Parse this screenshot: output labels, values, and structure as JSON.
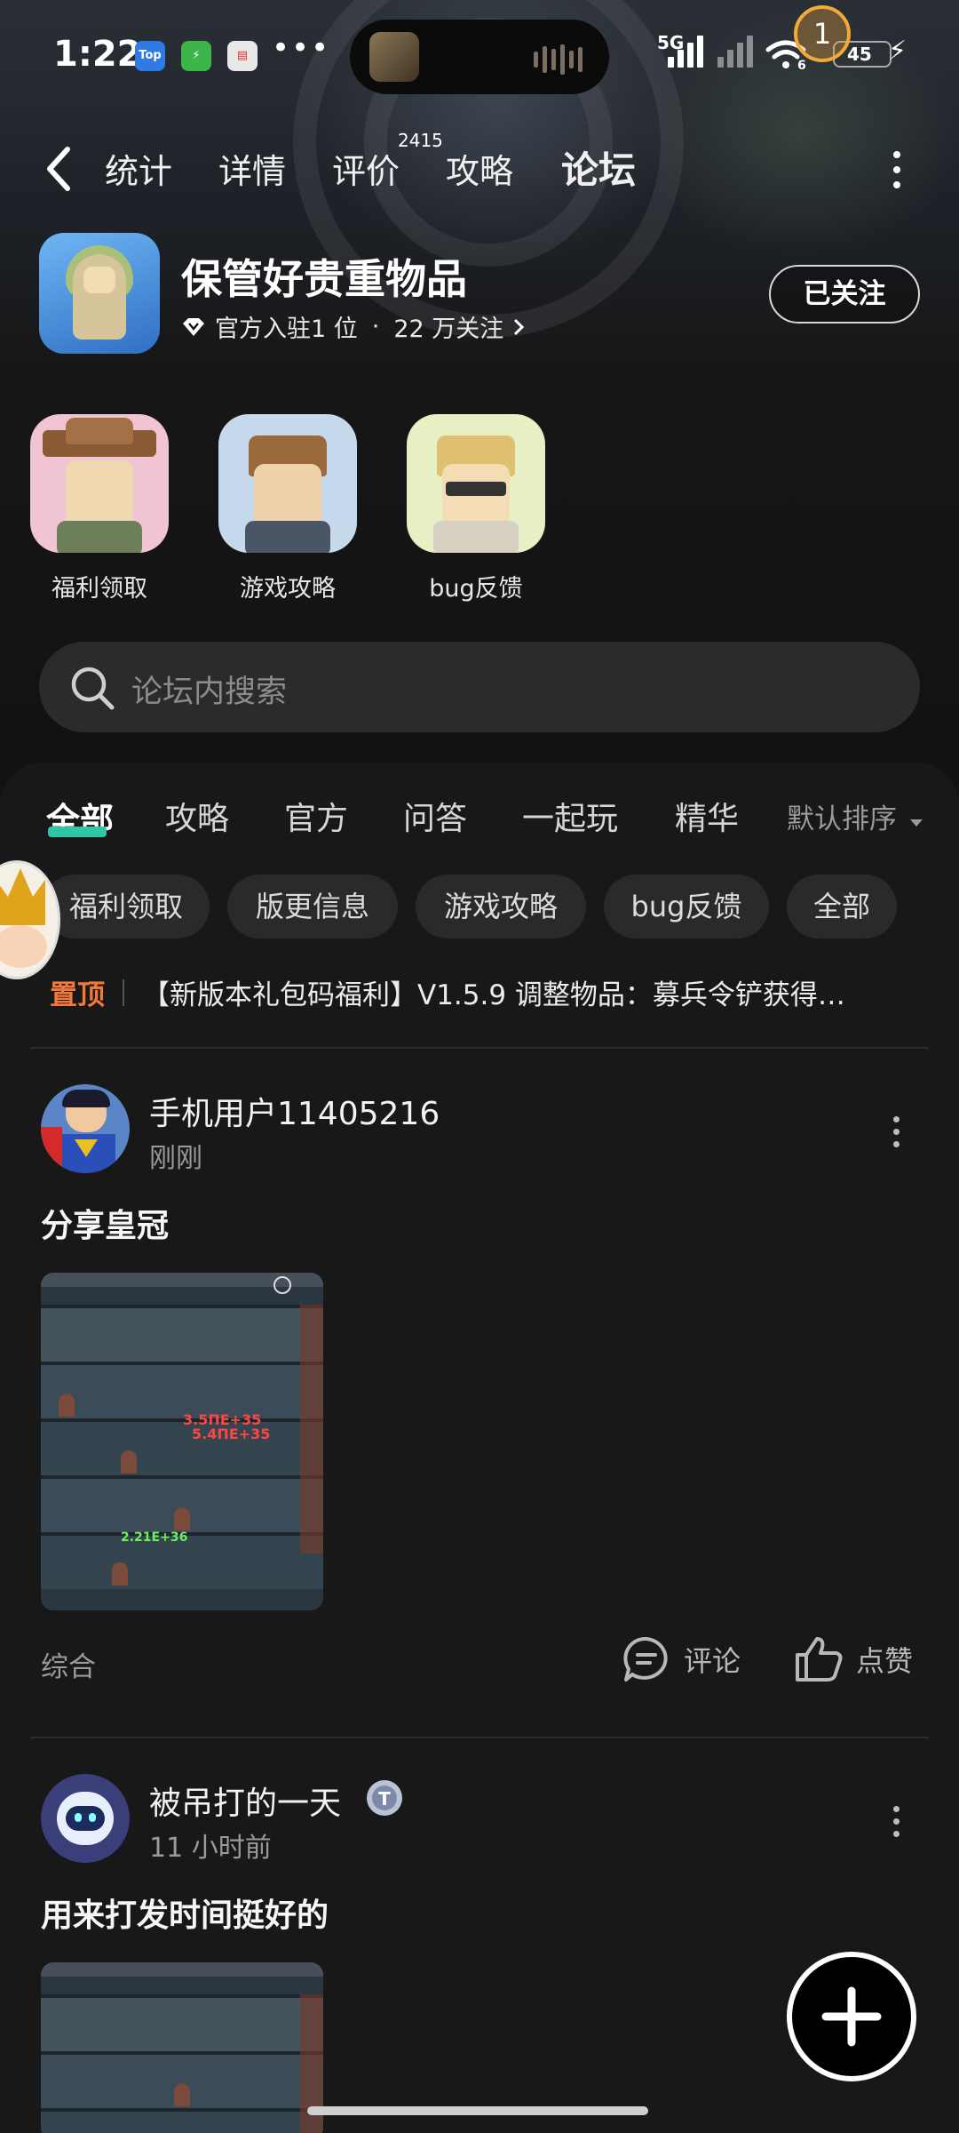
{
  "status_bar": {
    "time": "1:22",
    "app_icons": [
      "Top",
      "⚡",
      "▤"
    ],
    "more": "•••",
    "network": "5G",
    "wifi_num": "6",
    "battery": "45",
    "notification_count": "1"
  },
  "nav": {
    "tabs": [
      {
        "label": "统计"
      },
      {
        "label": "详情"
      },
      {
        "label": "评价",
        "badge": "2415"
      },
      {
        "label": "攻略"
      },
      {
        "label": "论坛",
        "active": true
      }
    ]
  },
  "game": {
    "title": "保管好贵重物品",
    "rank": "官方入驻1 位",
    "dot": "·",
    "followers": "22 万关注",
    "follow_button": "已关注"
  },
  "shortcuts": [
    {
      "label": "福利领取"
    },
    {
      "label": "游戏攻略"
    },
    {
      "label": "bug反馈"
    }
  ],
  "search": {
    "placeholder": "论坛内搜索"
  },
  "content_tabs": [
    "全部",
    "攻略",
    "官方",
    "问答",
    "一起玩",
    "精华"
  ],
  "sort": "默认排序",
  "chips": [
    "福利领取",
    "版更信息",
    "游戏攻略",
    "bug反馈",
    "全部"
  ],
  "pinned": {
    "tag": "置顶",
    "text": "【新版本礼包码福利】V1.5.9 调整物品：募兵令铲获得…"
  },
  "posts": [
    {
      "user": "手机用户11405216",
      "time": "刚刚",
      "title": "分享皇冠",
      "category": "综合",
      "comment": "评论",
      "like": "点赞"
    },
    {
      "user": "被吊打的一天",
      "time": "11 小时前",
      "title": "用来打发时间挺好的"
    }
  ],
  "colors": {
    "accent": "#2fc6a6",
    "pin": "#f17a3a",
    "background": "#121212"
  }
}
